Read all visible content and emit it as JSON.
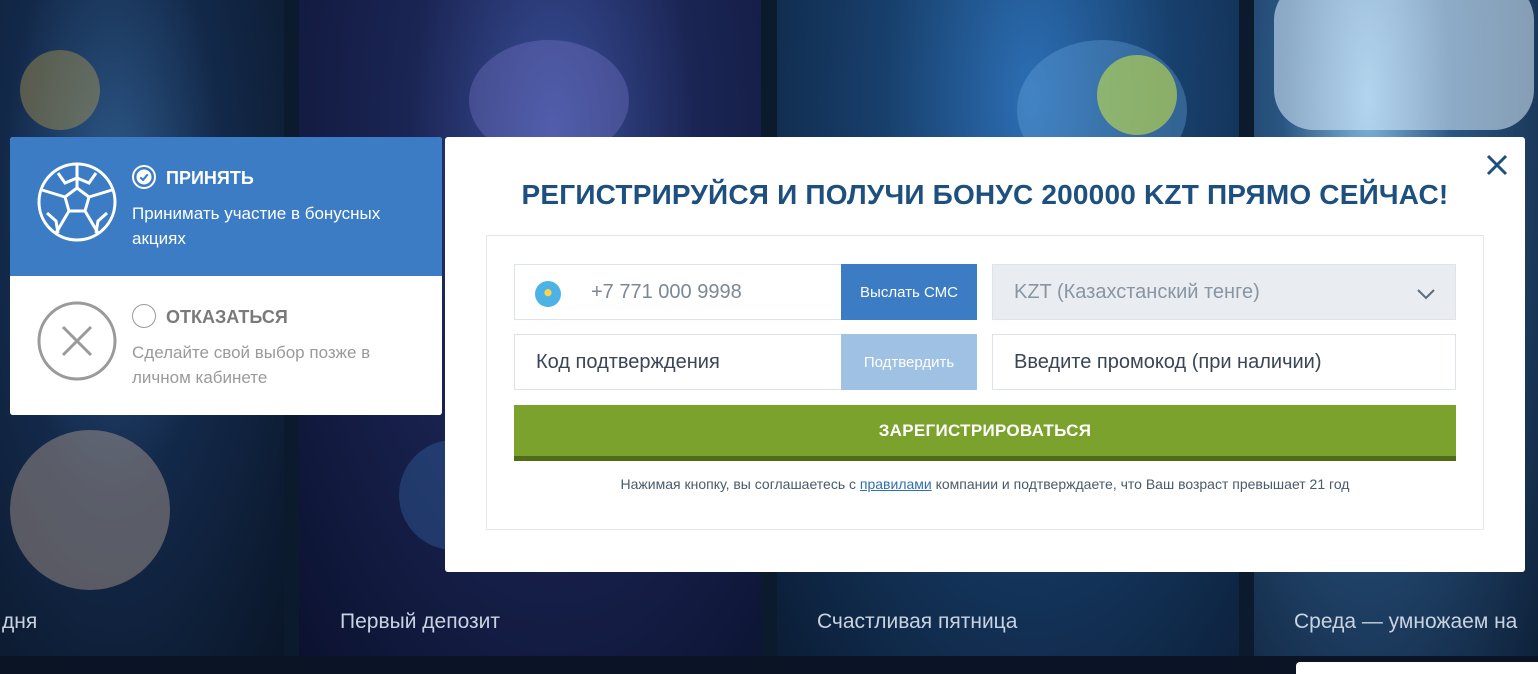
{
  "background": {
    "tiles": [
      {
        "caption": "дня"
      },
      {
        "caption": "Первый депозит"
      },
      {
        "caption": "Счастливая пятница"
      },
      {
        "caption": "Среда — умножаем на"
      }
    ]
  },
  "bonus_choice": {
    "accept": {
      "title": "ПРИНЯТЬ",
      "description": "Принимать участие в бонусных акциях",
      "icon": "soccer-ball-icon",
      "selected": true
    },
    "decline": {
      "title": "ОТКАЗАТЬСЯ",
      "description": "Сделайте свой выбор позже в личном кабинете",
      "icon": "cross-circle-icon",
      "selected": false
    }
  },
  "registration": {
    "title": "РЕГИСТРИРУЙСЯ И ПОЛУЧИ БОНУС 200000 KZT ПРЯМО СЕЙЧАС!",
    "phone": {
      "value": "+7 771 000 9998",
      "flag_icon": "kazakhstan-flag-icon"
    },
    "send_sms_label": "Выслать СМС",
    "currency": {
      "value": "KZT (Казахстанский тенге)"
    },
    "code_placeholder": "Код подтверждения",
    "confirm_label": "Подтвердить",
    "promo_placeholder": "Введите промокод (при наличии)",
    "register_label": "ЗАРЕГИСТРИРОВАТЬСЯ",
    "terms": {
      "before": "Нажимая кнопку, вы соглашаетесь с ",
      "link": "правилами",
      "after": " компании и подтверждаете, что Ваш возраст превышает 21 год"
    }
  },
  "colors": {
    "accent_blue": "#3b7cc4",
    "title_blue": "#1d4f7f",
    "register_green": "#7ba22c"
  }
}
